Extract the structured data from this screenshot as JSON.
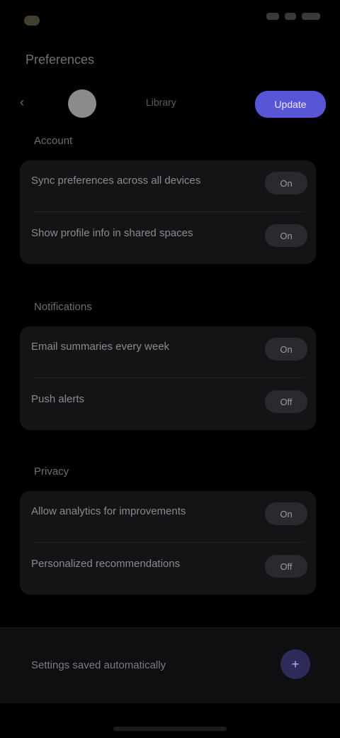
{
  "status": {
    "time": "",
    "icons": [
      "signal-icon",
      "wifi-icon",
      "battery-icon"
    ]
  },
  "header": {
    "title": "Preferences",
    "back_icon": "chevron-left-icon",
    "middle_label": "Library",
    "primary_button": "Update"
  },
  "sections": [
    {
      "title": "Account",
      "rows": [
        {
          "label": "Sync preferences across all devices",
          "action": "On"
        },
        {
          "label": "Show profile info in shared spaces",
          "action": "On"
        }
      ]
    },
    {
      "title": "Notifications",
      "rows": [
        {
          "label": "Email summaries every week",
          "action": "On"
        },
        {
          "label": "Push alerts",
          "action": "Off"
        }
      ]
    },
    {
      "title": "Privacy",
      "rows": [
        {
          "label": "Allow analytics for improvements",
          "action": "On"
        },
        {
          "label": "Personalized recommendations",
          "action": "Off"
        }
      ]
    }
  ],
  "bottom": {
    "text": "Settings saved automatically",
    "icon": "plus-icon"
  },
  "colors": {
    "accent": "#5856d6",
    "background": "#000000",
    "card": "#141416"
  }
}
